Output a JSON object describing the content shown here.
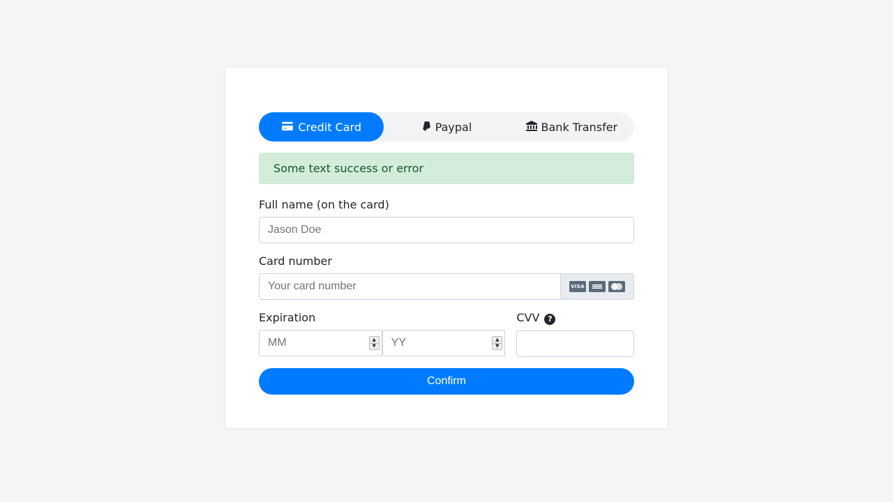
{
  "tabs": {
    "credit_card": "Credit Card",
    "paypal": "Paypal",
    "bank_transfer": "Bank Transfer"
  },
  "alert": {
    "message": "Some text success or error"
  },
  "form": {
    "full_name": {
      "label": "Full name (on the card)",
      "placeholder": "Jason Doe",
      "value": ""
    },
    "card_number": {
      "label": "Card number",
      "placeholder": "Your card number",
      "value": ""
    },
    "expiration": {
      "label": "Expiration",
      "month_placeholder": "MM",
      "year_placeholder": "YY",
      "month_value": "",
      "year_value": ""
    },
    "cvv": {
      "label": "CVV",
      "value": ""
    },
    "confirm_label": "Confirm"
  },
  "icons": {
    "credit_card": "credit-card-icon",
    "paypal": "paypal-icon",
    "bank": "bank-icon",
    "help": "?",
    "visa": "VISA",
    "amex": "amex",
    "mastercard": "mastercard"
  },
  "colors": {
    "primary": "#007bff",
    "alert_bg": "#d4edda",
    "alert_fg": "#155724"
  }
}
